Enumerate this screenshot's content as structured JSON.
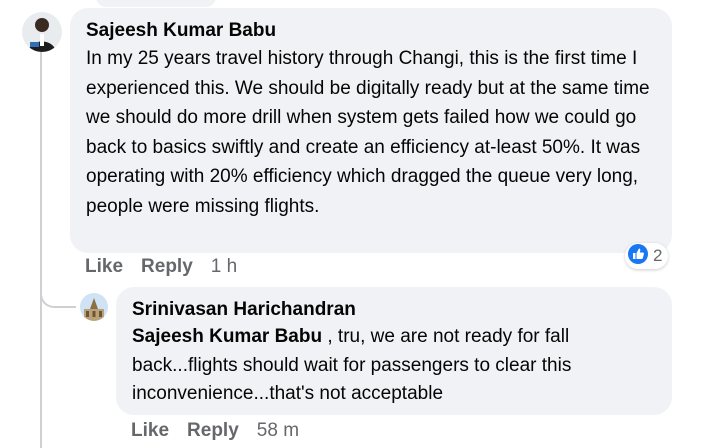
{
  "comments": [
    {
      "author": "Sajeesh Kumar Babu",
      "text": "In my 25 years travel history through Changi, this is the first time I experienced this. We should be digitally ready but at the same time we should do more drill when system gets failed how we could go back to basics swiftly and create an efficiency at-least 50%. It was operating with 20% efficiency which dragged the queue very long, people were missing flights.",
      "actions": {
        "like": "Like",
        "reply": "Reply",
        "time": "1 h"
      },
      "reaction": {
        "icon": "like-reaction-icon",
        "count": "2"
      }
    }
  ],
  "reply": {
    "author": "Srinivasan Harichandran",
    "mention": "Sajeesh Kumar Babu",
    "text": " , tru, we are not ready for fall back...flights should wait for passengers to clear this inconvenience...that's not acceptable",
    "actions": {
      "like": "Like",
      "reply": "Reply",
      "time": "58 m"
    }
  },
  "colors": {
    "bubble": "#f0f2f5",
    "meta": "#65676b",
    "like_blue": "#1877f2",
    "thread_line": "#ced0d4"
  }
}
